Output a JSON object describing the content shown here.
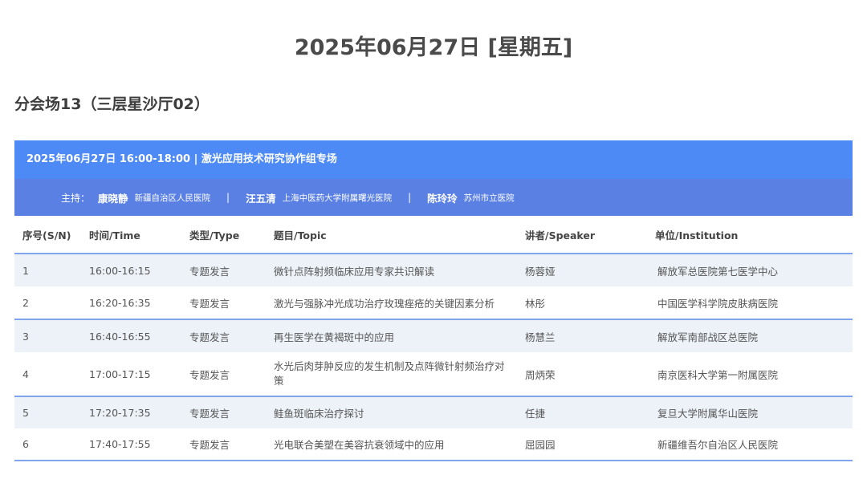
{
  "page": {
    "date_title": "2025年06月27日 [星期五]",
    "venue_title": "分会场13（三层星沙厅02）"
  },
  "session": {
    "header": "2025年06月27日 16:00-18:00 | 激光应用技术研究协作组专场",
    "hosts_label": "主持：",
    "separator": "|",
    "hosts": [
      {
        "name": "康晓静",
        "institution": "新疆自治区人民医院"
      },
      {
        "name": "汪五清",
        "institution": "上海中医药大学附属曙光医院"
      },
      {
        "name": "陈玲玲",
        "institution": "苏州市立医院"
      }
    ]
  },
  "table": {
    "columns": [
      "序号(S/N)",
      "时间/Time",
      "类型/Type",
      "题目/Topic",
      "讲者/Speaker",
      "单位/Institution"
    ],
    "rows": [
      {
        "sn": "1",
        "time": "16:00-16:15",
        "type": "专题发言",
        "topic": "微针点阵射频临床应用专家共识解读",
        "speaker": "杨蓉娅",
        "institution": "解放军总医院第七医学中心"
      },
      {
        "sn": "2",
        "time": "16:20-16:35",
        "type": "专题发言",
        "topic": "激光与强脉冲光成功治疗玫瑰痤疮的关键因素分析",
        "speaker": "林彤",
        "institution": "中国医学科学院皮肤病医院"
      },
      {
        "sn": "3",
        "time": "16:40-16:55",
        "type": "专题发言",
        "topic": "再生医学在黄褐斑中的应用",
        "speaker": "杨慧兰",
        "institution": "解放军南部战区总医院"
      },
      {
        "sn": "4",
        "time": "17:00-17:15",
        "type": "专题发言",
        "topic": "水光后肉芽肿反应的发生机制及点阵微针射频治疗对策",
        "speaker": "周炳荣",
        "institution": "南京医科大学第一附属医院"
      },
      {
        "sn": "5",
        "time": "17:20-17:35",
        "type": "专题发言",
        "topic": "鲑鱼斑临床治疗探讨",
        "speaker": "任捷",
        "institution": "复旦大学附属华山医院"
      },
      {
        "sn": "6",
        "time": "17:40-17:55",
        "type": "专题发言",
        "topic": "光电联合美塑在美容抗衰领域中的应用",
        "speaker": "屈园园",
        "institution": "新疆维吾尔自治区人民医院"
      }
    ]
  }
}
